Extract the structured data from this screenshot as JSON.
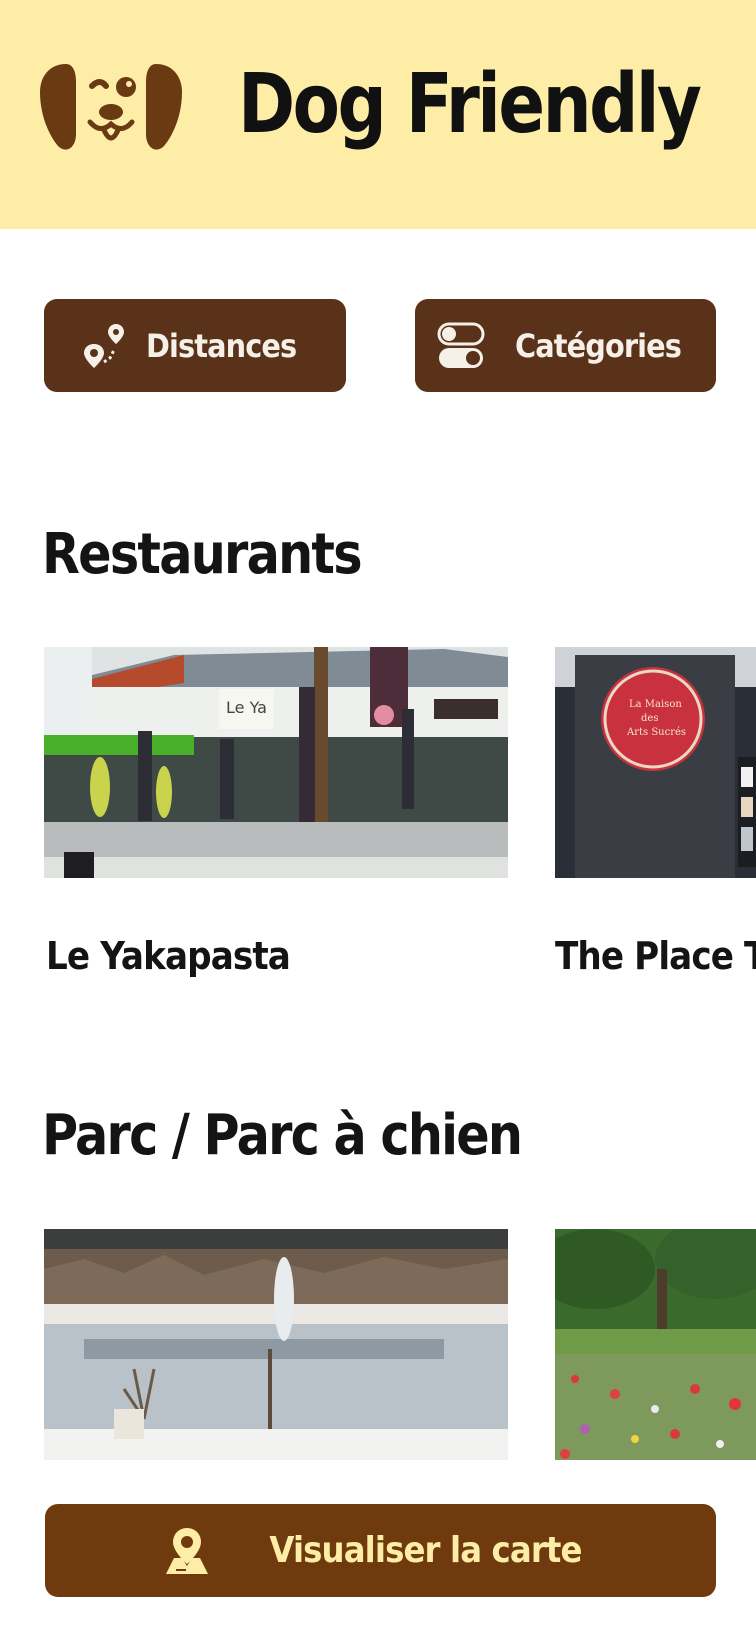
{
  "header": {
    "title": "Dog Friendly",
    "logo_icon": "dog-face-icon"
  },
  "filters": [
    {
      "label": "Distances",
      "icon": "map-pin-route-icon"
    },
    {
      "label": "Catégories",
      "icon": "toggle-switches-icon"
    }
  ],
  "sections": [
    {
      "title": "Restaurants",
      "cards": [
        {
          "name": "Le Yakapasta",
          "image_desc": "restaurant terrace photo"
        },
        {
          "name": "The Place T",
          "image_desc": "restaurant sign photo"
        }
      ]
    },
    {
      "title": "Parc / Parc à chien",
      "cards": [
        {
          "name": "",
          "image_desc": "frozen lake with fountain photo"
        },
        {
          "name": "",
          "image_desc": "park with wildflowers photo"
        }
      ]
    }
  ],
  "map_button": {
    "label": "Visualiser la carte",
    "icon": "map-location-icon"
  },
  "colors": {
    "header_bg": "#fdeda6",
    "button_brown": "#5a3119",
    "map_button_bg": "#6e3a0e",
    "map_button_text": "#fdeda6"
  }
}
